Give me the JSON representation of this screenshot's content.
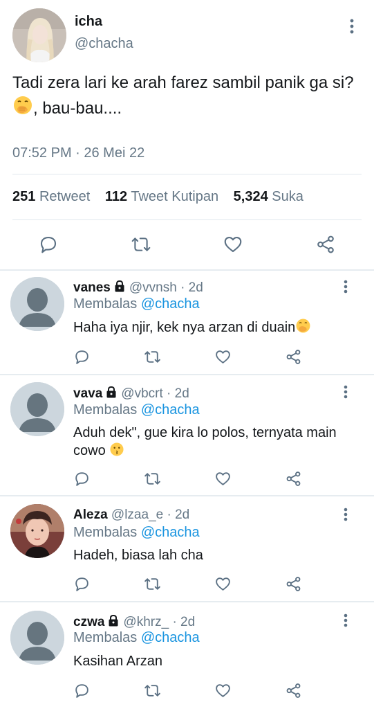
{
  "tweet": {
    "name": "icha",
    "handle": "@chacha",
    "text": "Tadi zera lari ke arah farez sambil panik ga si?",
    "text_tail": ", bau-bau....",
    "time": "07:52 PM · 26 Mei 22",
    "stats": {
      "retweets": "251",
      "retweets_label": "Retweet",
      "quotes": "112",
      "quotes_label": "Tweet Kutipan",
      "likes": "5,324",
      "likes_label": "Suka"
    }
  },
  "replies": [
    {
      "name": "vanes",
      "handle": "@vvnsh",
      "time": "· 2d",
      "replying": "Membalas",
      "replying_to": "@chacha",
      "text": "Haha iya njir, kek nya arzan di duain",
      "avatar": "default"
    },
    {
      "name": "vava",
      "handle": "@vbcrt",
      "time": "· 2d",
      "replying": "Membalas",
      "replying_to": "@chacha",
      "text": "Aduh dek\", gue kira lo polos, ternyata main cowo",
      "avatar": "default"
    },
    {
      "name": "Aleza",
      "handle": "@lzaa_e",
      "time": "· 2d",
      "replying": "Membalas",
      "replying_to": "@chacha",
      "text": "Hadeh, biasa lah cha",
      "avatar": "photo"
    },
    {
      "name": "czwa",
      "handle": "@khrz_",
      "time": "· 2d",
      "replying": "Membalas",
      "replying_to": "@chacha",
      "text": "Kasihan Arzan",
      "avatar": "default"
    }
  ],
  "icons": [
    "reply-icon",
    "retweet-icon",
    "like-icon",
    "share-icon",
    "lock-icon",
    "more-icon"
  ],
  "colors": {
    "accent": "#1b95e0",
    "secondary": "#657786",
    "icon": "#5b7083",
    "divider": "#e6ecf0"
  }
}
